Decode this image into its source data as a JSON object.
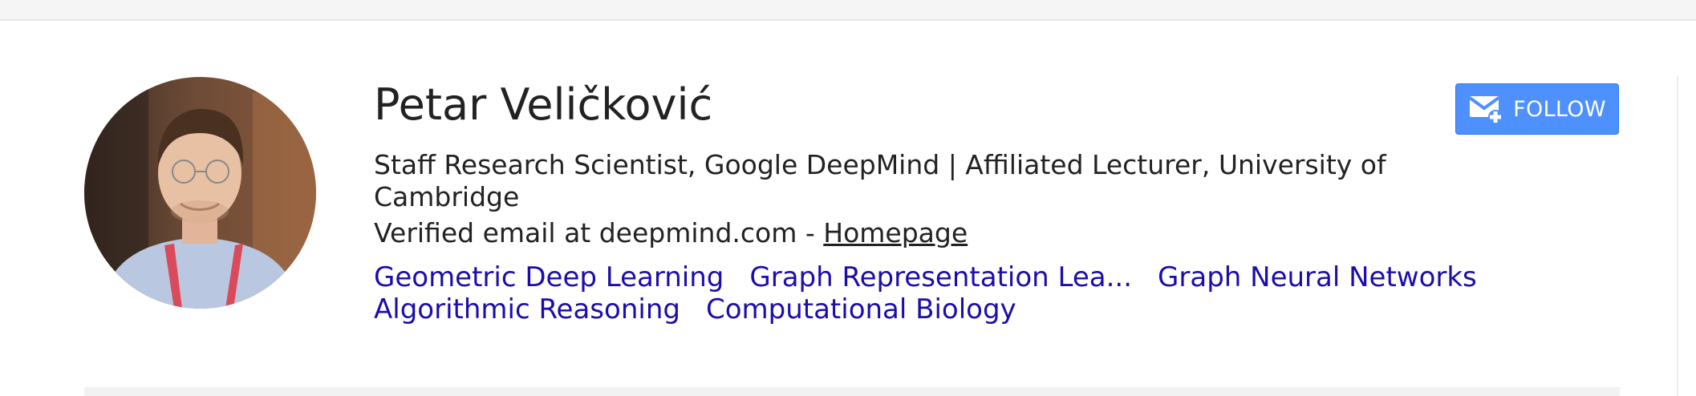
{
  "profile": {
    "name": "Petar Veličković",
    "affiliation": "Staff Research Scientist, Google DeepMind | Affiliated Lecturer, University of Cambridge",
    "email_text": "Verified email at deepmind.com - ",
    "homepage_label": "Homepage",
    "interests": [
      "Geometric Deep Learning",
      "Graph Representation Lea...",
      "Graph Neural Networks",
      "Algorithmic Reasoning",
      "Computational Biology"
    ]
  },
  "follow": {
    "label": "FOLLOW",
    "icon": "mail-plus-icon"
  },
  "colors": {
    "link": "#1a0dab",
    "button_bg": "#4d90fe",
    "button_text": "#ffffff",
    "text": "#222222"
  }
}
